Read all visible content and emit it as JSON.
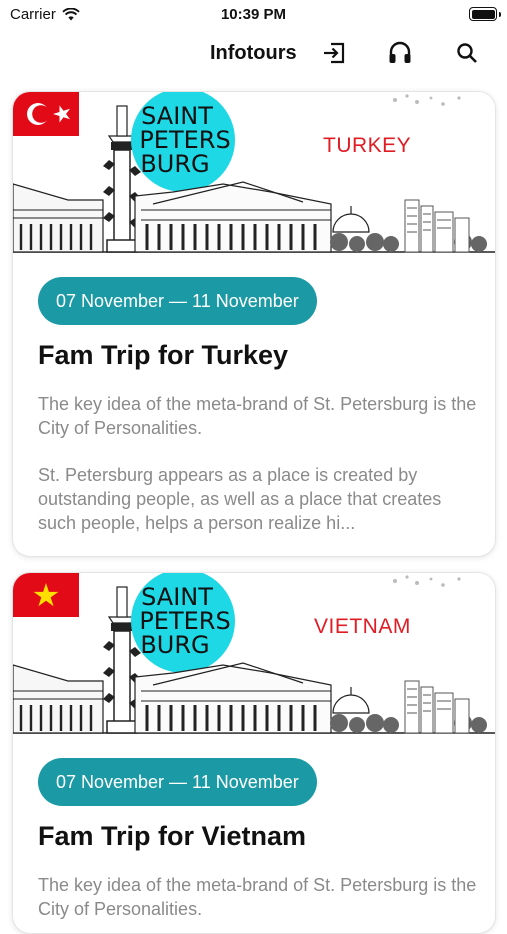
{
  "status_bar": {
    "carrier": "Carrier",
    "time": "10:39 PM"
  },
  "nav": {
    "title": "Infotours",
    "icons": [
      "login-icon",
      "headphones-icon",
      "search-icon"
    ]
  },
  "banner_logo": {
    "lines": [
      "SAINT",
      "PETERS",
      "BURG"
    ]
  },
  "cards": [
    {
      "country": "TURKEY",
      "flag": "turkey-flag",
      "dates": "07 November — 11 November",
      "title": "Fam Trip for Turkey",
      "desc1": "The key idea of the meta-brand of St. Petersburg is the City of Personalities.",
      "desc2": "St. Petersburg appears as a place is created by outstanding people, as well as a place that creates such people, helps a person realize hi..."
    },
    {
      "country": "VIETNAM",
      "flag": "vietnam-flag",
      "dates": "07 November — 11 November",
      "title": "Fam Trip for Vietnam",
      "desc1": "The key idea of the meta-brand of St. Petersburg is the City of Personalities."
    }
  ],
  "colors": {
    "accent": "#1b9aa5",
    "logo_circle": "#1fd8e6",
    "country_text": "#e01c24",
    "flag_red": "#e30a17",
    "star_yellow": "#ffde00"
  }
}
